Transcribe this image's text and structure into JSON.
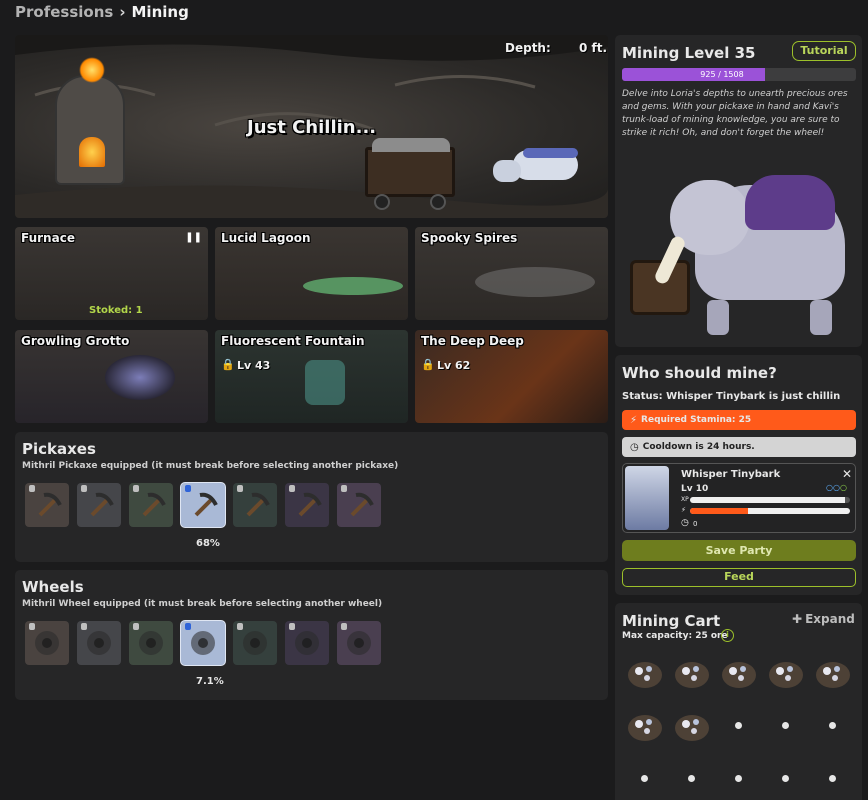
{
  "breadcrumb": {
    "root": "Professions",
    "separator": "›",
    "current": "Mining"
  },
  "scene": {
    "depth_label": "Depth:",
    "depth_value": "0 ft.",
    "status_text": "Just Chillin..."
  },
  "locations": [
    {
      "name": "Furnace",
      "extra": "Stoked: 1",
      "paused": true
    },
    {
      "name": "Lucid Lagoon"
    },
    {
      "name": "Spooky Spires"
    },
    {
      "name": "Growling Grotto"
    },
    {
      "name": "Fluorescent Fountain",
      "locked_level": "Lv 43"
    },
    {
      "name": "The Deep Deep",
      "locked_level": "Lv 62"
    }
  ],
  "pickaxes": {
    "title": "Pickaxes",
    "subtitle": "Mithril Pickaxe equipped (it must break before selecting another pickaxe)",
    "selected_durability": "68%",
    "items": [
      {
        "name": "copper-pickaxe",
        "bg": "#4a4340"
      },
      {
        "name": "iron-pickaxe",
        "bg": "#45464a"
      },
      {
        "name": "steel-pickaxe",
        "bg": "#3f4a40"
      },
      {
        "name": "mithril-pickaxe",
        "bg": "#a9b9d6",
        "selected": true
      },
      {
        "name": "emerald-pickaxe",
        "bg": "#35403d"
      },
      {
        "name": "obsidian-pickaxe",
        "bg": "#3b3545"
      },
      {
        "name": "gold-pickaxe",
        "bg": "#4a3f50"
      }
    ]
  },
  "wheels": {
    "title": "Wheels",
    "subtitle": "Mithril Wheel equipped (it must break before selecting another wheel)",
    "selected_durability": "7.1%",
    "items": [
      {
        "name": "copper-wheel",
        "bg": "#4a4340"
      },
      {
        "name": "iron-wheel",
        "bg": "#45464a"
      },
      {
        "name": "steel-wheel",
        "bg": "#3f4a40"
      },
      {
        "name": "mithril-wheel",
        "bg": "#a9b9d6",
        "selected": true
      },
      {
        "name": "emerald-wheel",
        "bg": "#35403d"
      },
      {
        "name": "obsidian-wheel",
        "bg": "#3b3545"
      },
      {
        "name": "gold-wheel",
        "bg": "#4a3f50"
      }
    ]
  },
  "mining_level": {
    "title": "Mining Level 35",
    "tutorial_label": "Tutorial",
    "xp_text": "925 / 1508",
    "xp_fraction": 0.613,
    "description": "Delve into Loria's depths to unearth precious ores and gems. With your pickaxe in hand and Kavi's trunk-load of mining knowledge, you are sure to strike it rich! Oh, and don't forget the wheel!"
  },
  "who_should_mine": {
    "title": "Who should mine?",
    "status": "Status: Whisper Tinybark is just chillin",
    "stamina": "Required Stamina: 25",
    "cooldown": "Cooldown is 24 hours.",
    "pet": {
      "name": "Whisper Tinybark",
      "level": "Lv 10",
      "xp_label": "XP",
      "xp_fraction": 0.97,
      "stamina_fraction": 0.36,
      "count": "0"
    },
    "save_label": "Save Party",
    "feed_label": "Feed"
  },
  "mining_cart": {
    "title": "Mining Cart",
    "expand_label": "Expand",
    "capacity": "Max capacity: 25 ore",
    "info_symbol": "i",
    "filled_slots": 7,
    "total_visible_slots": 15
  },
  "colors": {
    "accent_green": "#9cc02a",
    "xp_purple": "#9b52d8",
    "stamina_orange": "#ff5a1a",
    "button_olive": "#6e7d1e"
  }
}
